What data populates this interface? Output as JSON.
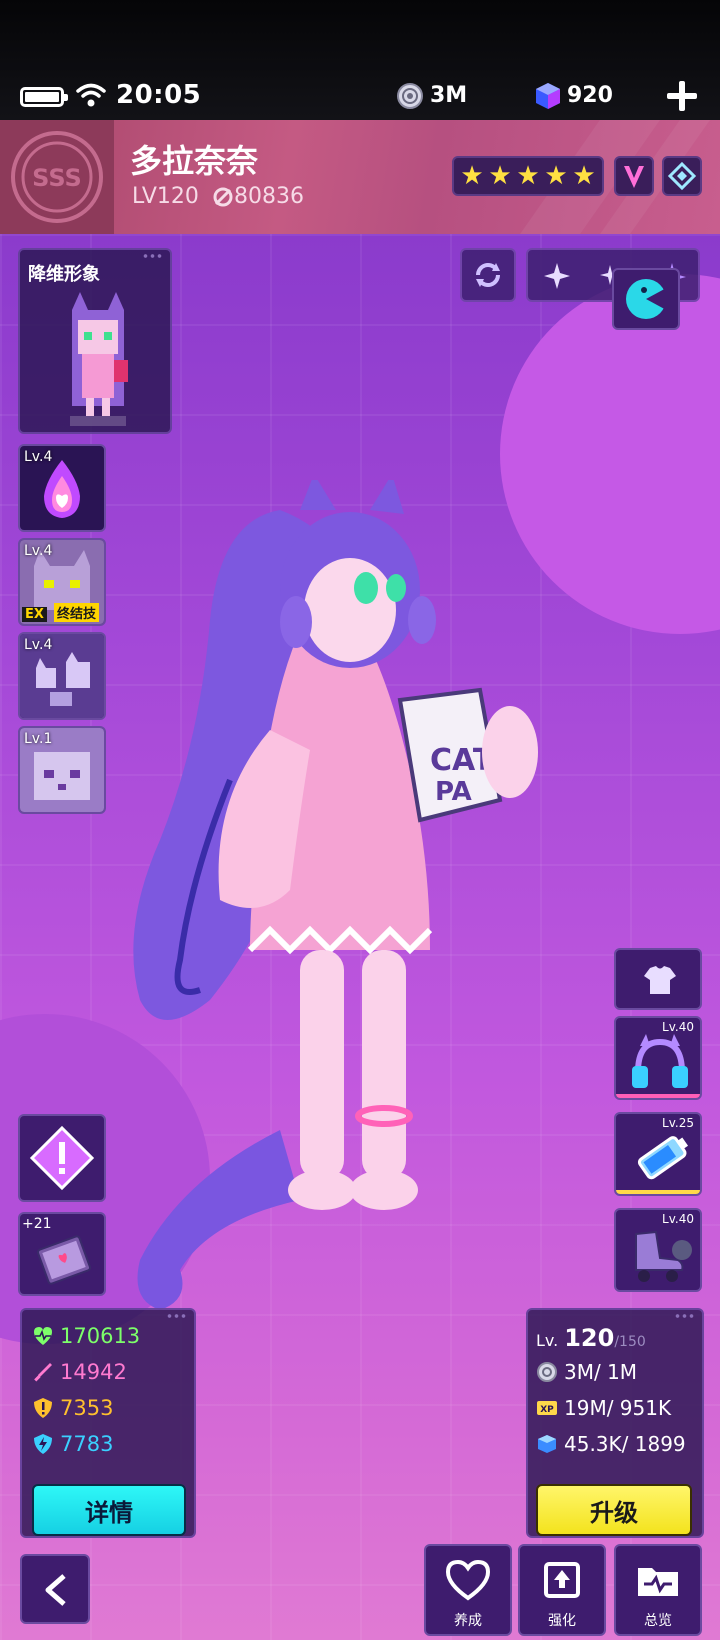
{
  "status": {
    "time": "20:05",
    "coins": "3M",
    "gems": "920"
  },
  "header": {
    "rank": "SSS",
    "name": "多拉奈奈",
    "level": "LV120",
    "power": "80836",
    "stars": 5
  },
  "avatar": {
    "title": "降维形象"
  },
  "skills": [
    {
      "level": "Lv.4"
    },
    {
      "level": "Lv.4",
      "ex": "EX",
      "ex_label": "终结技"
    },
    {
      "level": "Lv.4"
    },
    {
      "level": "Lv.1"
    }
  ],
  "equipment": [
    {
      "level": "Lv.40",
      "icon": "headphones-icon"
    },
    {
      "level": "Lv.25",
      "icon": "battery-icon"
    },
    {
      "level": "Lv.40",
      "icon": "skate-icon"
    }
  ],
  "book": {
    "count": "+21"
  },
  "stats": {
    "hp": "170613",
    "attack": "14942",
    "defense": "7353",
    "speed": "7783",
    "details_label": "详情",
    "colors": {
      "hp": "#7dff6a",
      "attack": "#ff7ad0",
      "defense": "#ffc02e",
      "speed": "#3ad0ff"
    }
  },
  "leveling": {
    "level_prefix": "Lv.",
    "level": "120",
    "level_max": "/150",
    "coins": "3M/ 1M",
    "xp": "19M/ 951K",
    "cubes": "45.3K/ 1899",
    "upgrade_label": "升级"
  },
  "nav": {
    "train": "养成",
    "enhance": "强化",
    "overview": "总览"
  },
  "colors": {
    "accent_cyan": "#2ef7f7",
    "accent_yellow": "#fff56a",
    "header_pink": "#c45a83"
  }
}
